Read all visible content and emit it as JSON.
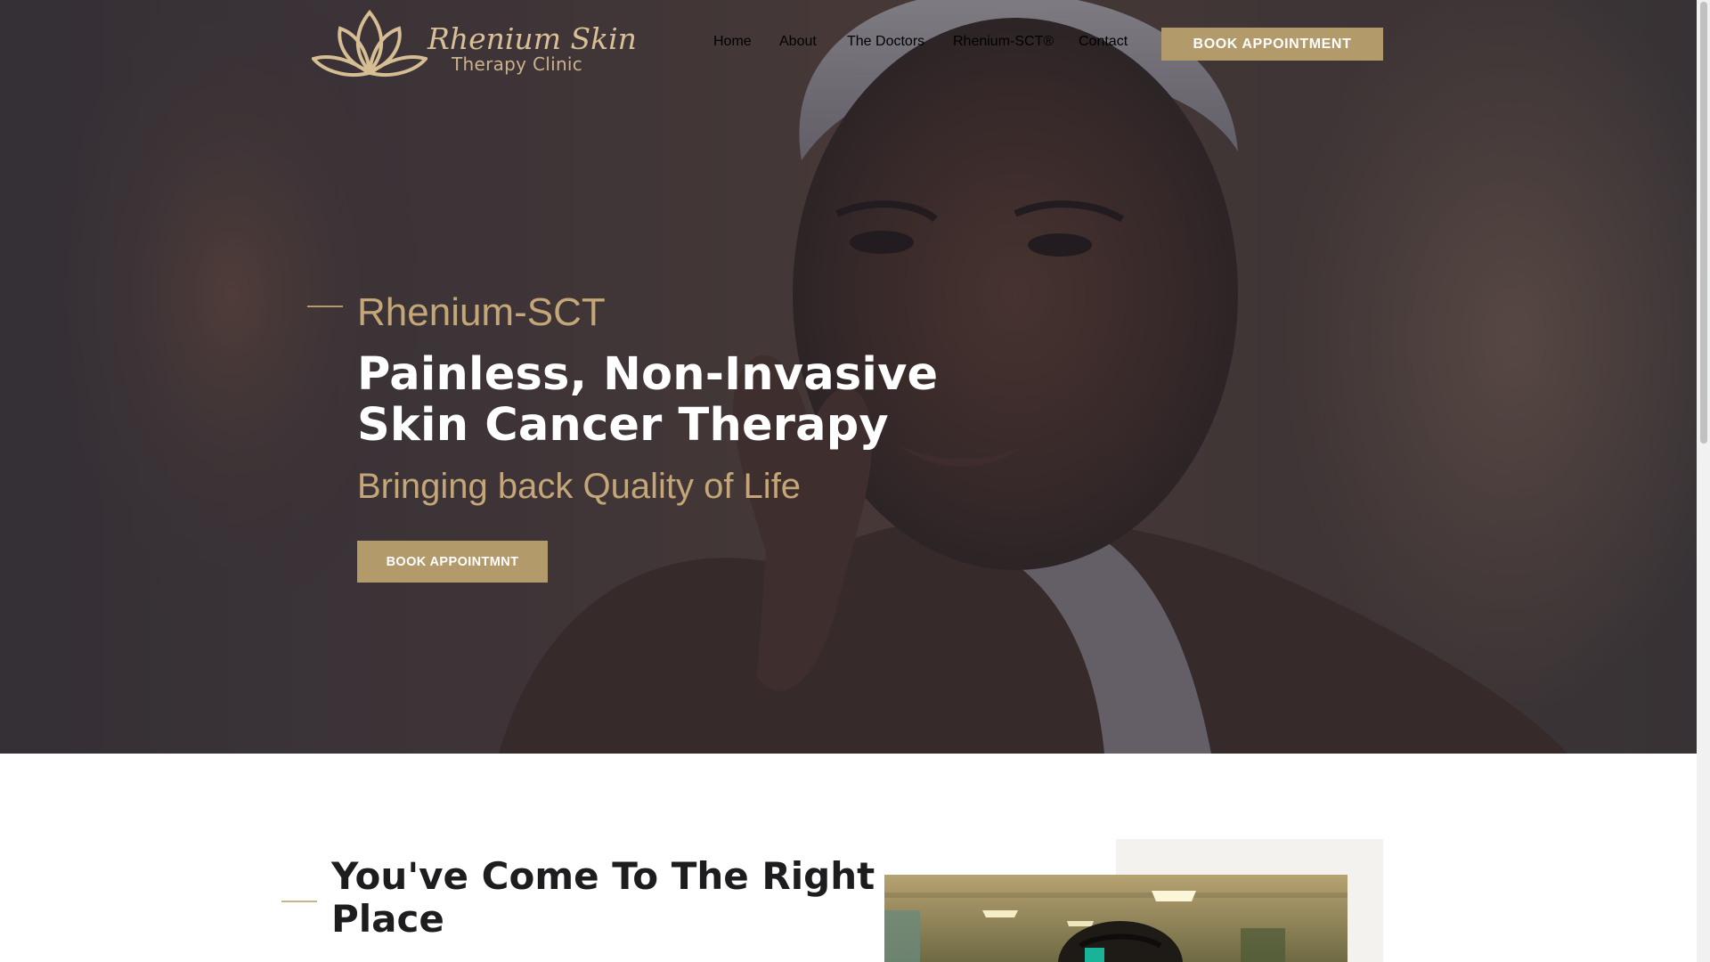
{
  "logo": {
    "name": "Rhenium Skin",
    "subtitle": "Therapy Clinic"
  },
  "nav": {
    "items": [
      {
        "id": "home",
        "label": "Home"
      },
      {
        "id": "about",
        "label": "About"
      },
      {
        "id": "doctors",
        "label": "The Doctors"
      },
      {
        "id": "rhenium-sct",
        "label": "Rhenium-SCT®"
      },
      {
        "id": "contact",
        "label": "Contact"
      }
    ],
    "cta_label": "BOOK APPOINTMENT"
  },
  "hero": {
    "kicker": "Rhenium-SCT",
    "title_line1": "Painless, Non-Invasive",
    "title_line2": "Skin Cancer Therapy",
    "tagline": "Bringing back Quality of Life",
    "cta_label": "BOOK APPOINTMNT"
  },
  "section2": {
    "title_line1": "You've Come To The Right",
    "title_line2": "Place"
  },
  "colors": {
    "accent_gold": "#b39a6b",
    "heading_gold": "#c4a678",
    "logo_gold": "#d9bf97",
    "dark_text": "#1d1d1f",
    "panel_beige": "#f4f2ee"
  },
  "icons": {
    "logo_mark": "lotus-icon"
  }
}
